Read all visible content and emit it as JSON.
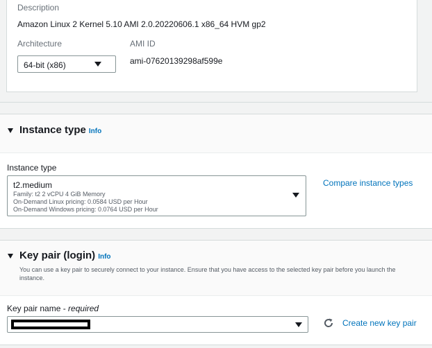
{
  "ami": {
    "description_label": "Description",
    "description_value": "Amazon Linux 2 Kernel 5.10 AMI 2.0.20220606.1 x86_64 HVM gp2",
    "architecture_label": "Architecture",
    "architecture_value": "64-bit (x86)",
    "ami_id_label": "AMI ID",
    "ami_id_value": "ami-07620139298af599e"
  },
  "instance_type": {
    "section_title": "Instance type",
    "info_link": "Info",
    "field_label": "Instance type",
    "selected_name": "t2.medium",
    "details_line": "Family: t2    2 vCPU    4 GiB Memory",
    "linux_pricing": "On-Demand Linux pricing: 0.0584 USD per Hour",
    "windows_pricing": "On-Demand Windows pricing: 0.0764 USD per Hour",
    "compare_link": "Compare instance types"
  },
  "key_pair": {
    "section_title": "Key pair (login)",
    "info_link": "Info",
    "description": "You can use a key pair to securely connect to your instance. Ensure that you have access to the selected key pair before you launch the instance.",
    "field_label": "Key pair name - ",
    "field_required": "required",
    "create_link": "Create new key pair"
  },
  "icons": {
    "expand": "caret-down-icon",
    "dropdown": "dropdown-caret-icon",
    "refresh": "refresh-icon"
  },
  "colors": {
    "link": "#0073bb",
    "text": "#16191f",
    "muted": "#687078",
    "border": "#879596"
  }
}
